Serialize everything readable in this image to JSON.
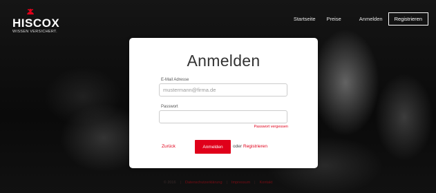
{
  "header": {
    "brand": {
      "name": "HISCOX",
      "tagline": "WISSEN VERSICHERT.",
      "icon": "hiscox-lion-icon",
      "brand_color": "#e0001a"
    },
    "nav": {
      "home": "Startseite",
      "prices": "Preise",
      "login": "Anmelden",
      "register": "Registrieren"
    }
  },
  "card": {
    "title": "Anmelden",
    "email": {
      "label": "E-Mail Adresse",
      "placeholder": "mustermann@firma.de",
      "value": ""
    },
    "password": {
      "label": "Passwort",
      "placeholder": "",
      "value": ""
    },
    "forgot_password": "Passwort vergessen",
    "back": "Zurück",
    "submit": "Anmelden",
    "or": "oder",
    "register": "Registrieren"
  },
  "footer": {
    "copyright": "© 2016",
    "privacy": "Datenschutzerklärung",
    "imprint": "Impressum",
    "contact": "Kontakt"
  }
}
